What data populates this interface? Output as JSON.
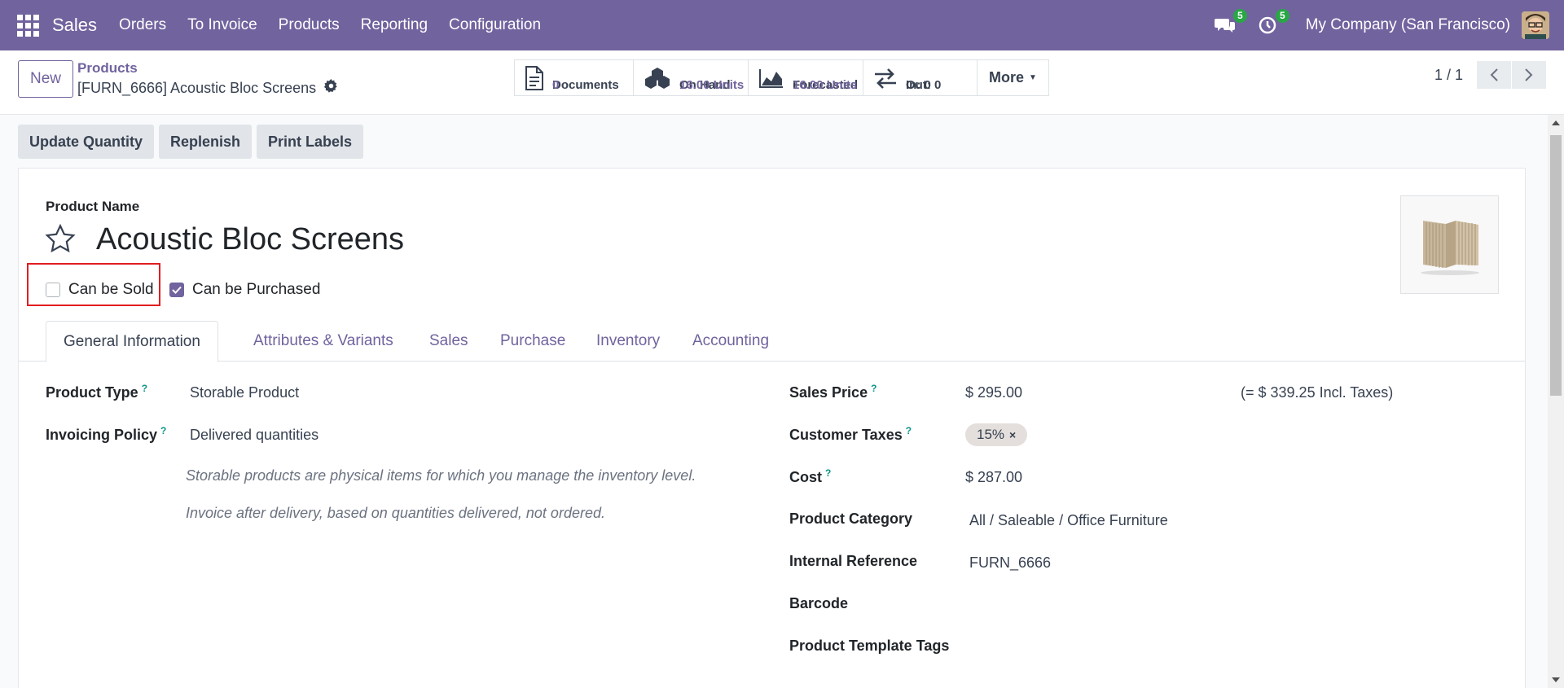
{
  "navbar": {
    "app_name": "Sales",
    "menu": [
      "Orders",
      "To Invoice",
      "Products",
      "Reporting",
      "Configuration"
    ],
    "messages_count": "5",
    "activities_count": "5",
    "company": "My Company (San Francisco)",
    "bg_color": "#71639e"
  },
  "control_panel": {
    "new_label": "New",
    "breadcrumb": "Products",
    "record_title": "[FURN_6666] Acoustic Bloc Screens",
    "smart_buttons": {
      "documents": {
        "label": "Documents",
        "value": "0"
      },
      "on_hand": {
        "label": "On Hand",
        "value": "16.00 Units"
      },
      "forecasted": {
        "label": "Forecasted",
        "value": "16.00 Units"
      },
      "moves": {
        "in_label": "In: 0",
        "out_label": "Out: 0"
      },
      "more_label": "More"
    },
    "pager": "1 / 1"
  },
  "actions": {
    "update_quantity": "Update Quantity",
    "replenish": "Replenish",
    "print_labels": "Print Labels"
  },
  "form": {
    "product_name_label": "Product Name",
    "product_name": "Acoustic Bloc Screens",
    "can_be_sold_label": "Can be Sold",
    "can_be_sold": false,
    "can_be_purchased_label": "Can be Purchased",
    "can_be_purchased": true,
    "tabs": [
      "General Information",
      "Attributes & Variants",
      "Sales",
      "Purchase",
      "Inventory",
      "Accounting"
    ],
    "active_tab": "General Information",
    "left": {
      "product_type_label": "Product Type",
      "product_type": "Storable Product",
      "invoicing_policy_label": "Invoicing Policy",
      "invoicing_policy": "Delivered quantities",
      "help_1": "Storable products are physical items for which you manage the inventory level.",
      "help_2": "Invoice after delivery, based on quantities delivered, not ordered."
    },
    "right": {
      "sales_price_label": "Sales Price",
      "sales_price": "$ 295.00",
      "incl_taxes": "(= $ 339.25 Incl. Taxes)",
      "customer_taxes_label": "Customer Taxes",
      "customer_tax_tag": "15%",
      "cost_label": "Cost",
      "cost": "$ 287.00",
      "product_category_label": "Product Category",
      "product_category": "All / Saleable / Office Furniture",
      "internal_reference_label": "Internal Reference",
      "internal_reference": "FURN_6666",
      "barcode_label": "Barcode",
      "product_template_tags_label": "Product Template Tags"
    },
    "help_marker": "?"
  }
}
